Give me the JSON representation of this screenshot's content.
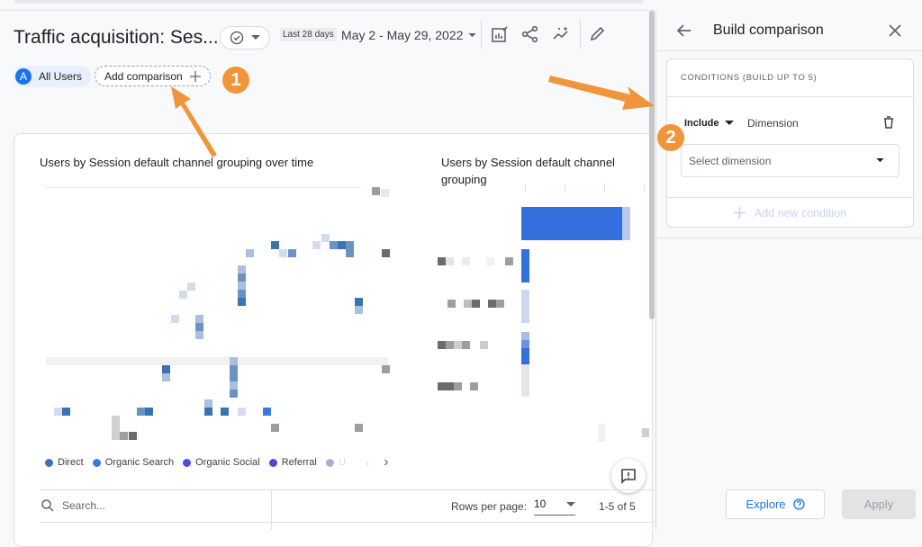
{
  "header": {
    "title": "Traffic acquisition: Ses...",
    "range_chip": "Last 28 days",
    "date_range": "May 2 - May 29, 2022"
  },
  "toolbar": {
    "icons": [
      "customize-report-icon",
      "share-icon",
      "insights-icon",
      "edit-icon"
    ]
  },
  "comparisons": {
    "all_users_avatar": "A",
    "all_users_label": "All Users",
    "add_comparison_label": "Add comparison"
  },
  "annotations": {
    "badge_1": "1",
    "badge_2": "2",
    "color": "#f0953a"
  },
  "charts": {
    "line_title": "Users by Session default channel grouping over time",
    "bar_title": "Users by Session default channel grouping",
    "legend": [
      {
        "label": "Direct",
        "color": "#3a74b0"
      },
      {
        "label": "Organic Search",
        "color": "#3b78e7"
      },
      {
        "label": "Organic Social",
        "color": "#4c4fd9"
      },
      {
        "label": "Referral",
        "color": "#5b3fd6"
      },
      {
        "label": "U",
        "color": "#b3a9d6"
      }
    ]
  },
  "table": {
    "search_placeholder": "Search...",
    "rows_per_page_label": "Rows per page:",
    "rows_per_page_value": "10",
    "pagination": "1-5 of 5"
  },
  "panel": {
    "title": "Build comparison",
    "conditions_header": "CONDITIONS (BUILD UP TO 5)",
    "include_label": "Include",
    "dimension_label": "Dimension",
    "select_placeholder": "Select dimension",
    "add_condition_label": "Add new condition",
    "explore_label": "Explore",
    "apply_label": "Apply"
  }
}
